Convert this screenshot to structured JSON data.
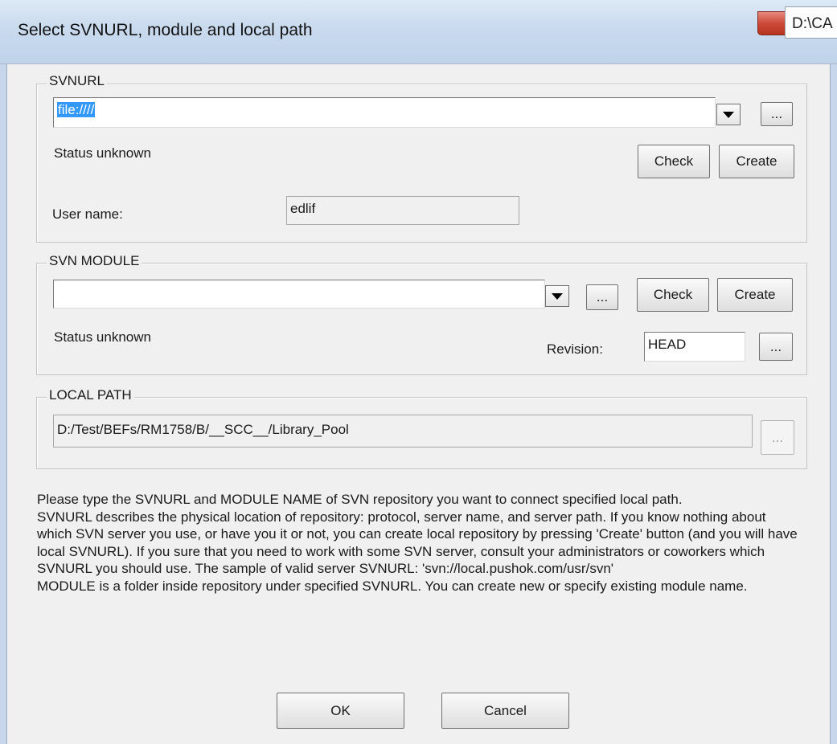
{
  "window": {
    "title": "Select SVNURL, module and local path",
    "tooltip_tab": "D:\\CA"
  },
  "svnurl": {
    "legend": "SVNURL",
    "value": "file:////",
    "browse_label": "...",
    "status": "Status unknown",
    "check_label": "Check",
    "create_label": "Create",
    "user_name_label": "User name:",
    "user_name_value": "edlif"
  },
  "svn_module": {
    "legend": "SVN MODULE",
    "value": "",
    "browse_label": "...",
    "check_label": "Check",
    "create_label": "Create",
    "status": "Status unknown",
    "revision_label": "Revision:",
    "revision_value": "HEAD",
    "revision_browse_label": "..."
  },
  "local_path": {
    "legend": "LOCAL PATH",
    "value": "D:/Test/BEFs/RM1758/B/__SCC__/Library_Pool",
    "browse_label": "..."
  },
  "help": {
    "p1": "Please type the SVNURL and MODULE NAME of SVN repository you want to connect specified local path.",
    "p2": "SVNURL describes the physical location of repository: protocol, server name, and server path.  If you know nothing about which SVN server you use, or have you it or not, you can create local repository by pressing 'Create' button (and you will have local SVNURL). If you sure that you need to work with some SVN server, consult your administrators or coworkers which SVNURL you should use. The sample of valid server SVNURL: 'svn://local.pushok.com/usr/svn'",
    "p3": "MODULE is a folder inside repository under specified SVNURL. You can create new or specify existing module name."
  },
  "footer": {
    "ok_label": "OK",
    "cancel_label": "Cancel"
  }
}
